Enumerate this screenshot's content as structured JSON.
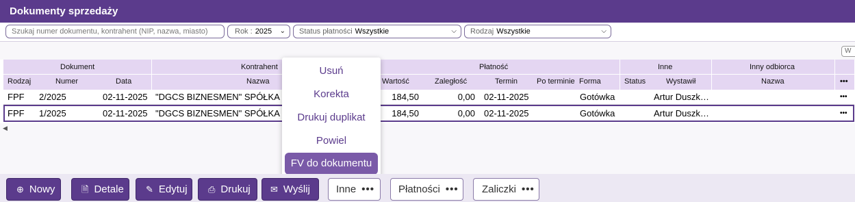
{
  "title": "Dokumenty sprzedaży",
  "filters": {
    "search_placeholder": "Szukaj  numer dokumentu, kontrahent (NIP, nazwa, miasto)",
    "rok_label": "Rok :",
    "rok_value": "2025",
    "status_label": "Status płatności",
    "status_value": "Wszystkie",
    "rodzaj_label": "Rodzaj",
    "rodzaj_value": "Wszystkie",
    "w_button": "W"
  },
  "grid": {
    "groups": {
      "dokument": "Dokument",
      "kontrahent": "Kontrahent",
      "platnosc": "Płatność",
      "inne": "Inne",
      "inny_odbiorca": "Inny odbiorca"
    },
    "columns": {
      "rodzaj": "Rodzaj",
      "numer": "Numer",
      "data": "Data",
      "nazwa": "Nazwa",
      "wartosc": "Wartość",
      "zaleglosc": "Zaległość",
      "termin": "Termin",
      "po_terminie": "Po terminie",
      "forma": "Forma",
      "status": "Status",
      "wystawil": "Wystawił",
      "odbiorca_nazwa": "Nazwa",
      "more": "•••"
    },
    "rows": [
      {
        "rodzaj": "FPF",
        "numer": "2/2025",
        "data": "02-11-2025",
        "nazwa": "\"DGCS BIZNESMEN\" SPÓŁKA Z",
        "wartosc": "184,50",
        "zaleglosc": "0,00",
        "termin": "02-11-2025",
        "forma": "Gotówka",
        "wystawil": "Artur Duszk…",
        "more": "•••"
      },
      {
        "rodzaj": "FPF",
        "numer": "1/2025",
        "data": "02-11-2025",
        "nazwa": "\"DGCS BIZNESMEN\" SPÓŁKA Z",
        "wartosc": "184,50",
        "zaleglosc": "0,00",
        "termin": "02-11-2025",
        "forma": "Gotówka",
        "wystawil": "Artur Duszk…",
        "more": "•••"
      }
    ]
  },
  "popup_menu": {
    "items": [
      "Usuń",
      "Korekta",
      "Drukuj duplikat",
      "Powiel",
      "FV do dokumentu"
    ]
  },
  "toolbar": {
    "nowy": "Nowy",
    "detale": "Detale",
    "edytuj": "Edytuj",
    "drukuj": "Drukuj",
    "wyslij": "Wyślij",
    "inne": "Inne",
    "platnosci": "Płatności",
    "zaliczki": "Zaliczki",
    "dots": "•••"
  },
  "colors": {
    "accent": "#5b3b8c",
    "header_bg": "#e4d6f2",
    "popup_active": "#7a5aa8"
  }
}
